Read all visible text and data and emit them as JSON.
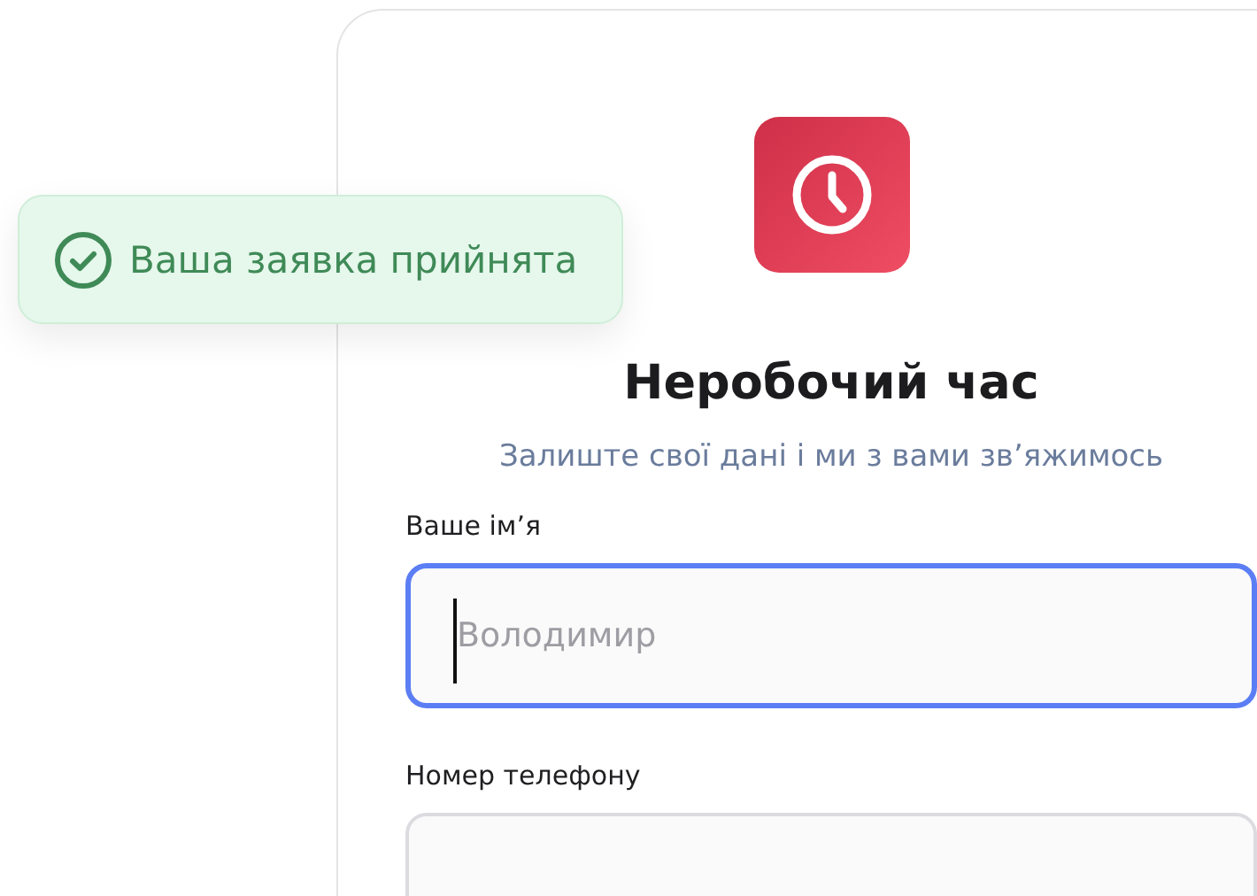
{
  "toast": {
    "message": "Ваша заявка прийнята"
  },
  "card": {
    "title": "Неробочий час",
    "subtitle": "Залиште свої дані і ми з вами зв’яжимось",
    "fields": [
      {
        "label": "Ваше імʼя",
        "placeholder": "Володимир",
        "focused": true
      },
      {
        "label": "Номер телефону",
        "focused": false
      }
    ]
  }
}
